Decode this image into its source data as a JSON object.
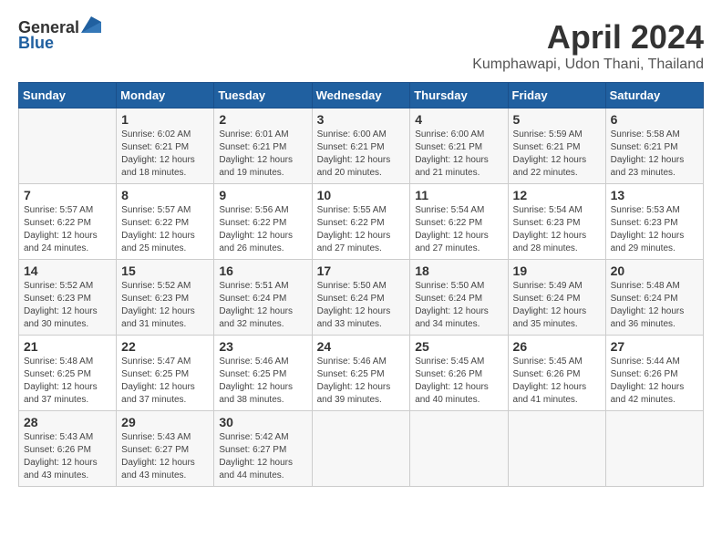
{
  "header": {
    "logo_general": "General",
    "logo_blue": "Blue",
    "month_title": "April 2024",
    "location": "Kumphawapi, Udon Thani, Thailand"
  },
  "calendar": {
    "days_of_week": [
      "Sunday",
      "Monday",
      "Tuesday",
      "Wednesday",
      "Thursday",
      "Friday",
      "Saturday"
    ],
    "weeks": [
      [
        {
          "day": "",
          "empty": true
        },
        {
          "day": "1",
          "sunrise": "Sunrise: 6:02 AM",
          "sunset": "Sunset: 6:21 PM",
          "daylight": "Daylight: 12 hours",
          "daylight2": "and 18 minutes."
        },
        {
          "day": "2",
          "sunrise": "Sunrise: 6:01 AM",
          "sunset": "Sunset: 6:21 PM",
          "daylight": "Daylight: 12 hours",
          "daylight2": "and 19 minutes."
        },
        {
          "day": "3",
          "sunrise": "Sunrise: 6:00 AM",
          "sunset": "Sunset: 6:21 PM",
          "daylight": "Daylight: 12 hours",
          "daylight2": "and 20 minutes."
        },
        {
          "day": "4",
          "sunrise": "Sunrise: 6:00 AM",
          "sunset": "Sunset: 6:21 PM",
          "daylight": "Daylight: 12 hours",
          "daylight2": "and 21 minutes."
        },
        {
          "day": "5",
          "sunrise": "Sunrise: 5:59 AM",
          "sunset": "Sunset: 6:21 PM",
          "daylight": "Daylight: 12 hours",
          "daylight2": "and 22 minutes."
        },
        {
          "day": "6",
          "sunrise": "Sunrise: 5:58 AM",
          "sunset": "Sunset: 6:21 PM",
          "daylight": "Daylight: 12 hours",
          "daylight2": "and 23 minutes."
        }
      ],
      [
        {
          "day": "7",
          "sunrise": "Sunrise: 5:57 AM",
          "sunset": "Sunset: 6:22 PM",
          "daylight": "Daylight: 12 hours",
          "daylight2": "and 24 minutes."
        },
        {
          "day": "8",
          "sunrise": "Sunrise: 5:57 AM",
          "sunset": "Sunset: 6:22 PM",
          "daylight": "Daylight: 12 hours",
          "daylight2": "and 25 minutes."
        },
        {
          "day": "9",
          "sunrise": "Sunrise: 5:56 AM",
          "sunset": "Sunset: 6:22 PM",
          "daylight": "Daylight: 12 hours",
          "daylight2": "and 26 minutes."
        },
        {
          "day": "10",
          "sunrise": "Sunrise: 5:55 AM",
          "sunset": "Sunset: 6:22 PM",
          "daylight": "Daylight: 12 hours",
          "daylight2": "and 27 minutes."
        },
        {
          "day": "11",
          "sunrise": "Sunrise: 5:54 AM",
          "sunset": "Sunset: 6:22 PM",
          "daylight": "Daylight: 12 hours",
          "daylight2": "and 27 minutes."
        },
        {
          "day": "12",
          "sunrise": "Sunrise: 5:54 AM",
          "sunset": "Sunset: 6:23 PM",
          "daylight": "Daylight: 12 hours",
          "daylight2": "and 28 minutes."
        },
        {
          "day": "13",
          "sunrise": "Sunrise: 5:53 AM",
          "sunset": "Sunset: 6:23 PM",
          "daylight": "Daylight: 12 hours",
          "daylight2": "and 29 minutes."
        }
      ],
      [
        {
          "day": "14",
          "sunrise": "Sunrise: 5:52 AM",
          "sunset": "Sunset: 6:23 PM",
          "daylight": "Daylight: 12 hours",
          "daylight2": "and 30 minutes."
        },
        {
          "day": "15",
          "sunrise": "Sunrise: 5:52 AM",
          "sunset": "Sunset: 6:23 PM",
          "daylight": "Daylight: 12 hours",
          "daylight2": "and 31 minutes."
        },
        {
          "day": "16",
          "sunrise": "Sunrise: 5:51 AM",
          "sunset": "Sunset: 6:24 PM",
          "daylight": "Daylight: 12 hours",
          "daylight2": "and 32 minutes."
        },
        {
          "day": "17",
          "sunrise": "Sunrise: 5:50 AM",
          "sunset": "Sunset: 6:24 PM",
          "daylight": "Daylight: 12 hours",
          "daylight2": "and 33 minutes."
        },
        {
          "day": "18",
          "sunrise": "Sunrise: 5:50 AM",
          "sunset": "Sunset: 6:24 PM",
          "daylight": "Daylight: 12 hours",
          "daylight2": "and 34 minutes."
        },
        {
          "day": "19",
          "sunrise": "Sunrise: 5:49 AM",
          "sunset": "Sunset: 6:24 PM",
          "daylight": "Daylight: 12 hours",
          "daylight2": "and 35 minutes."
        },
        {
          "day": "20",
          "sunrise": "Sunrise: 5:48 AM",
          "sunset": "Sunset: 6:24 PM",
          "daylight": "Daylight: 12 hours",
          "daylight2": "and 36 minutes."
        }
      ],
      [
        {
          "day": "21",
          "sunrise": "Sunrise: 5:48 AM",
          "sunset": "Sunset: 6:25 PM",
          "daylight": "Daylight: 12 hours",
          "daylight2": "and 37 minutes."
        },
        {
          "day": "22",
          "sunrise": "Sunrise: 5:47 AM",
          "sunset": "Sunset: 6:25 PM",
          "daylight": "Daylight: 12 hours",
          "daylight2": "and 37 minutes."
        },
        {
          "day": "23",
          "sunrise": "Sunrise: 5:46 AM",
          "sunset": "Sunset: 6:25 PM",
          "daylight": "Daylight: 12 hours",
          "daylight2": "and 38 minutes."
        },
        {
          "day": "24",
          "sunrise": "Sunrise: 5:46 AM",
          "sunset": "Sunset: 6:25 PM",
          "daylight": "Daylight: 12 hours",
          "daylight2": "and 39 minutes."
        },
        {
          "day": "25",
          "sunrise": "Sunrise: 5:45 AM",
          "sunset": "Sunset: 6:26 PM",
          "daylight": "Daylight: 12 hours",
          "daylight2": "and 40 minutes."
        },
        {
          "day": "26",
          "sunrise": "Sunrise: 5:45 AM",
          "sunset": "Sunset: 6:26 PM",
          "daylight": "Daylight: 12 hours",
          "daylight2": "and 41 minutes."
        },
        {
          "day": "27",
          "sunrise": "Sunrise: 5:44 AM",
          "sunset": "Sunset: 6:26 PM",
          "daylight": "Daylight: 12 hours",
          "daylight2": "and 42 minutes."
        }
      ],
      [
        {
          "day": "28",
          "sunrise": "Sunrise: 5:43 AM",
          "sunset": "Sunset: 6:26 PM",
          "daylight": "Daylight: 12 hours",
          "daylight2": "and 43 minutes."
        },
        {
          "day": "29",
          "sunrise": "Sunrise: 5:43 AM",
          "sunset": "Sunset: 6:27 PM",
          "daylight": "Daylight: 12 hours",
          "daylight2": "and 43 minutes."
        },
        {
          "day": "30",
          "sunrise": "Sunrise: 5:42 AM",
          "sunset": "Sunset: 6:27 PM",
          "daylight": "Daylight: 12 hours",
          "daylight2": "and 44 minutes."
        },
        {
          "day": "",
          "empty": true
        },
        {
          "day": "",
          "empty": true
        },
        {
          "day": "",
          "empty": true
        },
        {
          "day": "",
          "empty": true
        }
      ]
    ]
  }
}
